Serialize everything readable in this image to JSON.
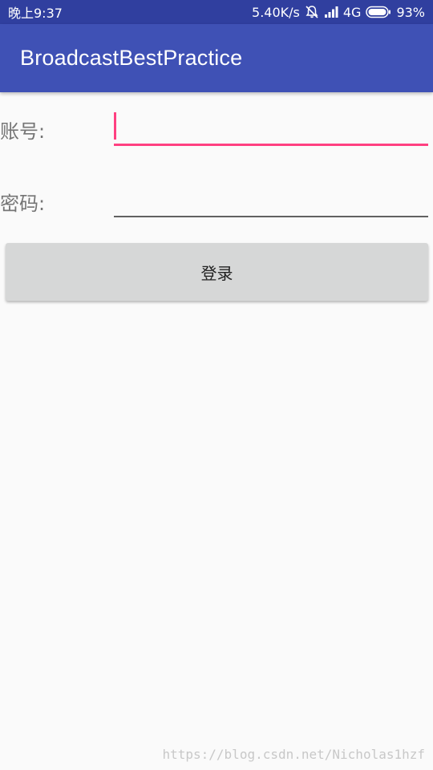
{
  "status_bar": {
    "time": "晚上9:37",
    "network_speed": "5.40K/s",
    "network_type": "4G",
    "battery": "93%",
    "icons": [
      "bell-off-icon",
      "signal-icon",
      "battery-icon"
    ]
  },
  "app_bar": {
    "title": "BroadcastBestPractice",
    "color": "#3f51b5",
    "status_color": "#303f9f"
  },
  "form": {
    "account_label": "账号:",
    "account_value": "",
    "password_label": "密码:",
    "password_value": "",
    "accent_color": "#ff4081"
  },
  "login_button": {
    "label": "登录"
  },
  "watermark": "https://blog.csdn.net/Nicholas1hzf"
}
